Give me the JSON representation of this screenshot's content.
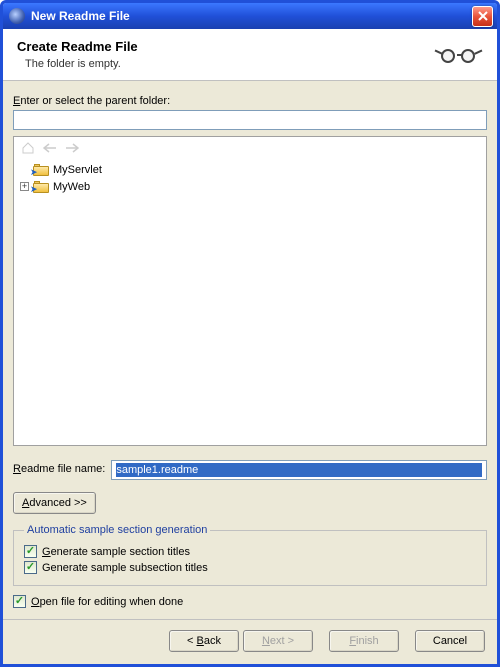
{
  "window": {
    "title": "New Readme File"
  },
  "banner": {
    "heading": "Create Readme File",
    "message": "The folder is empty."
  },
  "parentFolder": {
    "label_pre": "E",
    "label_post": "nter or select the parent folder:",
    "value": ""
  },
  "tree": {
    "items": [
      {
        "label": "MyServlet",
        "expandable": false
      },
      {
        "label": "MyWeb",
        "expandable": true
      }
    ]
  },
  "fileName": {
    "label_pre": "R",
    "label_post": "eadme file name:",
    "value": "sample1.readme"
  },
  "advanced": {
    "label_pre": "A",
    "label_post": "dvanced >>"
  },
  "group": {
    "legend": "Automatic sample section generation",
    "opt1": {
      "checked": true,
      "pre": "G",
      "post": "enerate sample section titles"
    },
    "opt2": {
      "checked": true,
      "label": "Generate sample subsection titles"
    }
  },
  "openFile": {
    "checked": true,
    "pre": "O",
    "post": "pen file for editing when done"
  },
  "buttons": {
    "back": {
      "pre": "< ",
      "u": "B",
      "post": "ack"
    },
    "next": {
      "pre": "",
      "u": "N",
      "post": "ext >"
    },
    "finish": {
      "pre": "",
      "u": "F",
      "post": "inish"
    },
    "cancel": "Cancel"
  }
}
